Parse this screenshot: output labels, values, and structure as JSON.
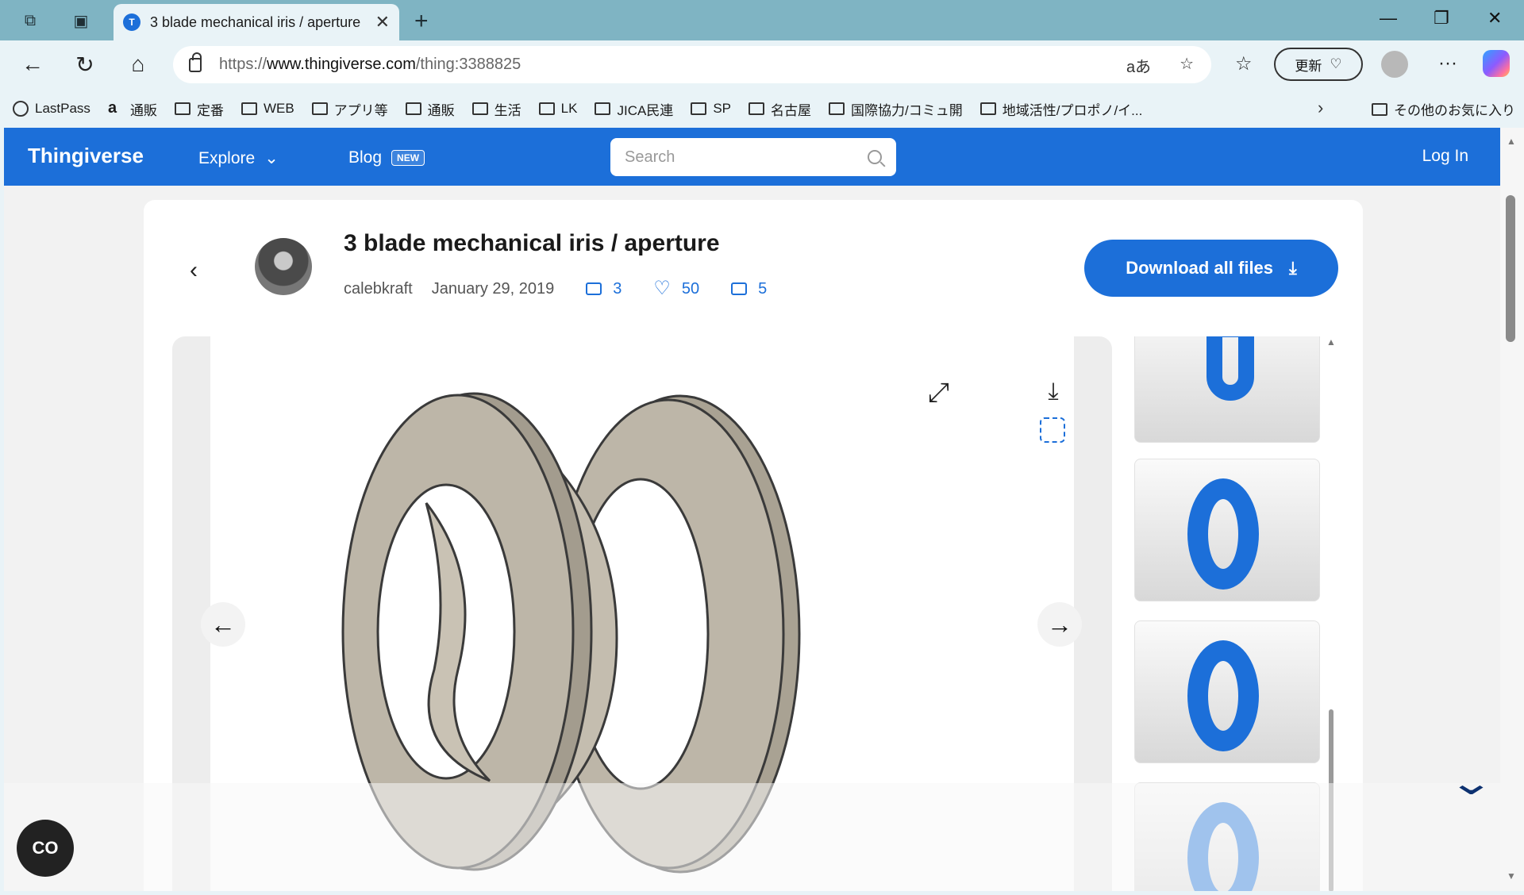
{
  "browser": {
    "tab_title": "3 blade mechanical iris / aperture",
    "url_prefix": "https://",
    "url_host": "www.thingiverse.com",
    "url_path": "/thing:3388825",
    "translate_label": "aあ",
    "update_label": "更新",
    "bookmarks": [
      {
        "label": "LastPass",
        "icon": "globe-icon"
      },
      {
        "label": "通販",
        "icon": "amazon-icon"
      },
      {
        "label": "定番",
        "icon": "folder-icon"
      },
      {
        "label": "WEB",
        "icon": "folder-icon"
      },
      {
        "label": "アプリ等",
        "icon": "folder-icon"
      },
      {
        "label": "通販",
        "icon": "folder-icon"
      },
      {
        "label": "生活",
        "icon": "folder-icon"
      },
      {
        "label": "LK",
        "icon": "folder-icon"
      },
      {
        "label": "JICA民連",
        "icon": "folder-icon"
      },
      {
        "label": "SP",
        "icon": "folder-icon"
      },
      {
        "label": "名古屋",
        "icon": "folder-icon"
      },
      {
        "label": "国際協力/コミュ開",
        "icon": "folder-icon"
      },
      {
        "label": "地域活性/プロポノ/イ...",
        "icon": "folder-icon"
      }
    ],
    "other_bookmarks": "その他のお気に入り"
  },
  "site": {
    "logo": "Thingiverse",
    "nav_explore": "Explore",
    "nav_blog": "Blog",
    "blog_badge": "NEW",
    "search_placeholder": "Search",
    "login": "Log In"
  },
  "thing": {
    "title": "3 blade mechanical iris / aperture",
    "author": "calebkraft",
    "date": "January 29, 2019",
    "comments": "3",
    "likes": "50",
    "collections": "5",
    "download_label": "Download all files"
  },
  "floating": {
    "co_label": "CO"
  },
  "colors": {
    "brand": "#1c6fd9",
    "tabbar": "#7fb4c3"
  }
}
